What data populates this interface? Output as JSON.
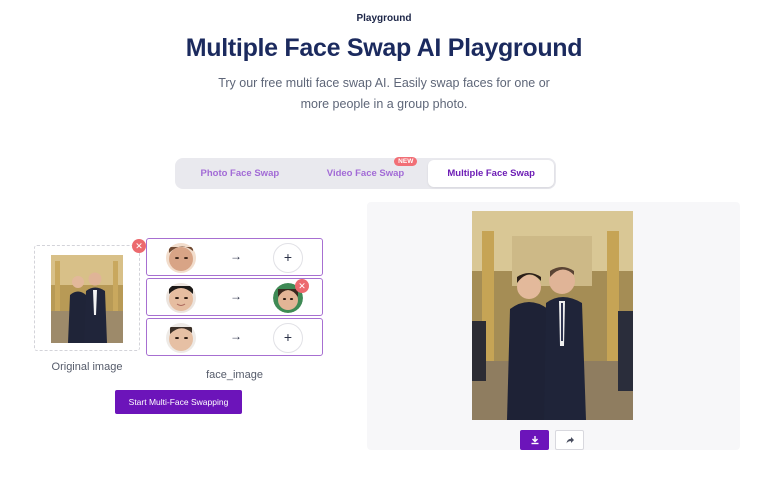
{
  "header": {
    "eyebrow": "Playground",
    "title": "Multiple Face Swap AI Playground",
    "subtitle_line1": "Try our free multi face swap AI. Easily swap faces for one or",
    "subtitle_line2": "more people in a group photo."
  },
  "tabs": [
    {
      "label": "Photo Face Swap",
      "active": false
    },
    {
      "label": "Video Face Swap",
      "active": false,
      "badge": "NEW"
    },
    {
      "label": "Multiple Face Swap",
      "active": true
    }
  ],
  "original": {
    "label": "Original image",
    "remove_icon": "close-icon"
  },
  "faces": {
    "label": "face_image",
    "rows": [
      {
        "arrow": "→",
        "target_placeholder": "+",
        "has_target": false
      },
      {
        "arrow": "→",
        "target_placeholder": "+",
        "has_target": true
      },
      {
        "arrow": "→",
        "target_placeholder": "+",
        "has_target": false
      }
    ]
  },
  "actions": {
    "start_label": "Start Multi-Face Swapping"
  },
  "result": {
    "download_icon": "download-icon",
    "share_icon": "share-icon"
  },
  "colors": {
    "accent": "#6c14ba",
    "title": "#1b2a5e",
    "badge": "#f16f76",
    "remove": "#ec6a6e"
  }
}
